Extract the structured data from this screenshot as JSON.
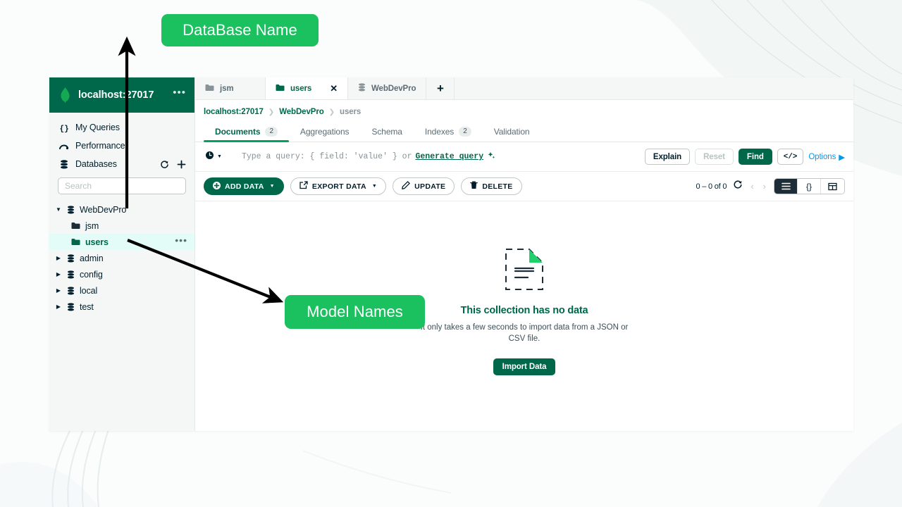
{
  "connection": {
    "title": "localhost:27017",
    "logo_icon": "mongodb-leaf-icon",
    "more_icon": "ellipsis-icon"
  },
  "sidebar": {
    "nav": [
      {
        "label": "My Queries",
        "icon": "braces-icon"
      },
      {
        "label": "Performance",
        "icon": "performance-icon"
      },
      {
        "label": "Databases",
        "icon": "database-icon"
      }
    ],
    "databases_actions": [
      {
        "icon": "refresh-icon",
        "name": "refresh-databases-button"
      },
      {
        "icon": "plus-icon",
        "name": "create-database-button"
      }
    ],
    "search": {
      "placeholder": "Search",
      "value": ""
    },
    "tree": [
      {
        "label": "WebDevPro",
        "type": "database",
        "icon": "database-icon",
        "expanded": true,
        "caret": "▼",
        "selected": false
      },
      {
        "label": "jsm",
        "type": "collection",
        "icon": "folder-icon",
        "selected": false
      },
      {
        "label": "users",
        "type": "collection",
        "icon": "folder-icon",
        "selected": true,
        "more_icon": "ellipsis-icon"
      },
      {
        "label": "admin",
        "type": "database",
        "icon": "database-icon",
        "expanded": false,
        "caret": "▶",
        "selected": false
      },
      {
        "label": "config",
        "type": "database",
        "icon": "database-icon",
        "expanded": false,
        "caret": "▶",
        "selected": false
      },
      {
        "label": "local",
        "type": "database",
        "icon": "database-icon",
        "expanded": false,
        "caret": "▶",
        "selected": false
      },
      {
        "label": "test",
        "type": "database",
        "icon": "database-icon",
        "expanded": false,
        "caret": "▶",
        "selected": false
      }
    ]
  },
  "tabs": [
    {
      "label": "jsm",
      "icon": "folder-icon",
      "active": false,
      "closable": false
    },
    {
      "label": "users",
      "icon": "folder-icon",
      "active": true,
      "closable": true,
      "close_icon": "close-icon"
    },
    {
      "label": "WebDevPro",
      "icon": "database-icon",
      "active": false,
      "closable": false
    }
  ],
  "tab_add": {
    "icon": "plus-icon",
    "label": "+"
  },
  "breadcrumb": [
    {
      "label": "localhost:27017"
    },
    {
      "label": "WebDevPro"
    },
    {
      "label": "users"
    }
  ],
  "breadcrumb_separator": "❯",
  "subtabs": [
    {
      "label": "Documents",
      "badge": "2",
      "active": true
    },
    {
      "label": "Aggregations",
      "badge": "",
      "active": false
    },
    {
      "label": "Schema",
      "badge": "",
      "active": false
    },
    {
      "label": "Indexes",
      "badge": "2",
      "active": false
    },
    {
      "label": "Validation",
      "badge": "",
      "active": false
    }
  ],
  "querybar": {
    "history_icon": "clock-icon",
    "history_caret": "▼",
    "placeholder": "Type a query: { field: 'value' } or",
    "generate_label": "Generate query",
    "generate_icon": "sparkle-icon",
    "explain_label": "Explain",
    "reset_label": "Reset",
    "find_label": "Find",
    "code_label": "</>",
    "options_label": "Options",
    "options_caret": "▶"
  },
  "toolbar": {
    "add_data_label": "ADD DATA",
    "add_data_icon": "plus-circle-icon",
    "export_data_label": "EXPORT DATA",
    "export_data_icon": "export-icon",
    "update_label": "UPDATE",
    "update_icon": "pencil-icon",
    "delete_label": "DELETE",
    "delete_icon": "trash-icon",
    "caret": "▼",
    "count": "0 – 0 of 0",
    "refresh_icon": "refresh-icon",
    "prev_icon": "‹",
    "next_icon": "›",
    "views": [
      {
        "name": "list-view-button",
        "icon": "list-icon",
        "label": "☰",
        "active": true
      },
      {
        "name": "json-view-button",
        "icon": "braces-icon",
        "label": "{}",
        "active": false
      },
      {
        "name": "table-view-button",
        "icon": "table-icon",
        "label": "⊞",
        "active": false
      }
    ]
  },
  "empty_state": {
    "icon": "empty-document-icon",
    "title": "This collection has no data",
    "subtitle": "It only takes a few seconds to import data from a JSON or CSV file.",
    "button_label": "Import Data"
  },
  "annotations": [
    {
      "label": "DataBase Name",
      "color": "#1bc15e"
    },
    {
      "label": "Model Names",
      "color": "#1bc15e"
    }
  ]
}
